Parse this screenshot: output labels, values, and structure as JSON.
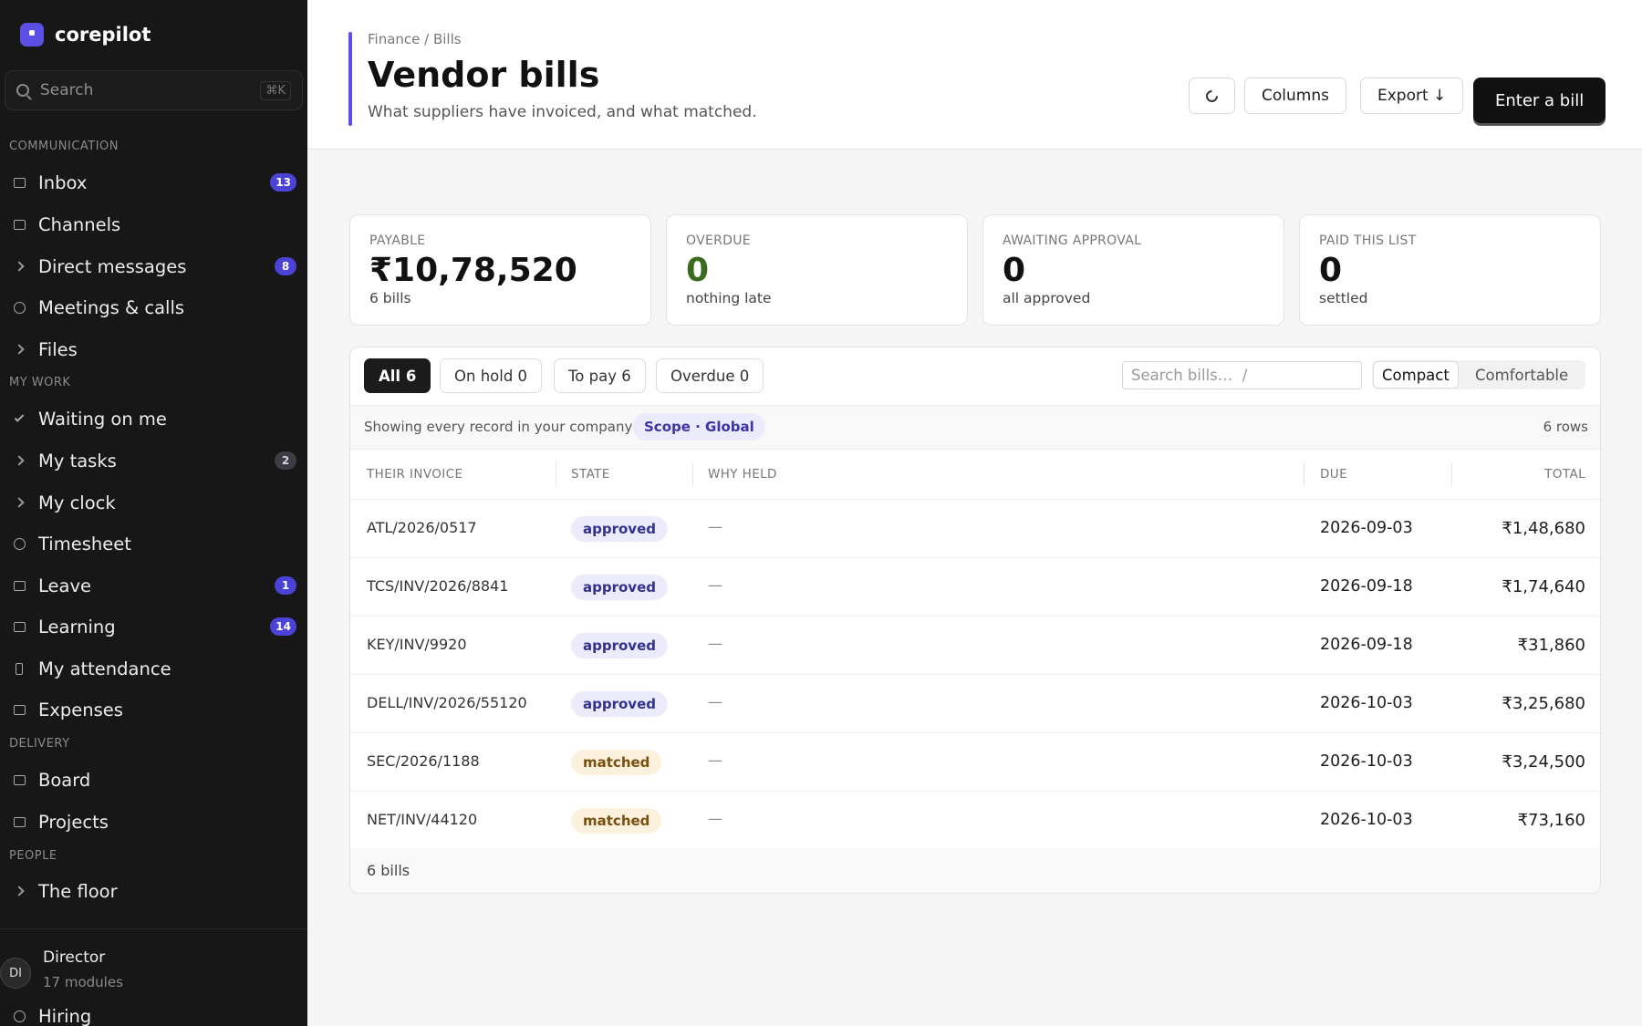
{
  "brand": {
    "name": "corepilot"
  },
  "search": {
    "placeholder": "Search",
    "shortcut": "⌘K"
  },
  "sections": {
    "communication": "COMMUNICATION",
    "my_work": "MY WORK",
    "delivery": "DELIVERY",
    "people": "PEOPLE"
  },
  "nav": {
    "inbox": {
      "label": "Inbox",
      "badge": "13"
    },
    "channels": {
      "label": "Channels"
    },
    "direct_messages": {
      "label": "Direct messages",
      "badge": "8"
    },
    "meetings": {
      "label": "Meetings & calls"
    },
    "files": {
      "label": "Files"
    },
    "waiting": {
      "label": "Waiting on me"
    },
    "tasks": {
      "label": "My tasks",
      "badge": "2"
    },
    "clock": {
      "label": "My clock"
    },
    "timesheet": {
      "label": "Timesheet"
    },
    "leave": {
      "label": "Leave",
      "badge": "1"
    },
    "learning": {
      "label": "Learning",
      "badge": "14"
    },
    "attendance": {
      "label": "My attendance"
    },
    "expenses": {
      "label": "Expenses"
    },
    "board": {
      "label": "Board"
    },
    "projects": {
      "label": "Projects"
    },
    "floor": {
      "label": "The floor"
    },
    "hiring": {
      "label": "Hiring"
    }
  },
  "user": {
    "initials": "DI",
    "name": "Director",
    "modules": "17 modules"
  },
  "header": {
    "breadcrumb": "Finance / Bills",
    "title": "Vendor bills",
    "subtitle": "What suppliers have invoiced, and what matched.",
    "columns_label": "Columns",
    "export_label": "Export ↓",
    "enter_label": "Enter a bill"
  },
  "stats": [
    {
      "label": "PAYABLE",
      "value": "₹10,78,520",
      "sub": "6 bills"
    },
    {
      "label": "OVERDUE",
      "value": "0",
      "sub": "nothing late"
    },
    {
      "label": "AWAITING APPROVAL",
      "value": "0",
      "sub": "all approved"
    },
    {
      "label": "PAID THIS LIST",
      "value": "0",
      "sub": "settled"
    }
  ],
  "filters": {
    "all": "All 6",
    "on_hold": "On hold 0",
    "to_pay": "To pay 6",
    "overdue": "Overdue 0",
    "search_placeholder": "Search bills…  /",
    "compact": "Compact",
    "comfortable": "Comfortable"
  },
  "scope": {
    "text": "Showing every record in your company",
    "pill": "Scope · Global",
    "rows": "6 rows"
  },
  "table": {
    "headers": {
      "invoice": "THEIR INVOICE",
      "state": "STATE",
      "why": "WHY HELD",
      "due": "DUE",
      "total": "TOTAL"
    },
    "rows": [
      {
        "invoice": "ATL/2026/0517",
        "state": "approved",
        "why": "—",
        "due": "2026-09-03",
        "total": "₹1,48,680"
      },
      {
        "invoice": "TCS/INV/2026/8841",
        "state": "approved",
        "why": "—",
        "due": "2026-09-18",
        "total": "₹1,74,640"
      },
      {
        "invoice": "KEY/INV/9920",
        "state": "approved",
        "why": "—",
        "due": "2026-09-18",
        "total": "₹31,860"
      },
      {
        "invoice": "DELL/INV/2026/55120",
        "state": "approved",
        "why": "—",
        "due": "2026-10-03",
        "total": "₹3,25,680"
      },
      {
        "invoice": "SEC/2026/1188",
        "state": "matched",
        "why": "—",
        "due": "2026-10-03",
        "total": "₹3,24,500"
      },
      {
        "invoice": "NET/INV/44120",
        "state": "matched",
        "why": "—",
        "due": "2026-10-03",
        "total": "₹73,160"
      }
    ],
    "footer": "6 bills"
  },
  "colors": {
    "accent": "#5b4fe6",
    "sidebar": "#171717",
    "badge": "#4b42d6",
    "overdue_green": "#3b6b1e"
  }
}
